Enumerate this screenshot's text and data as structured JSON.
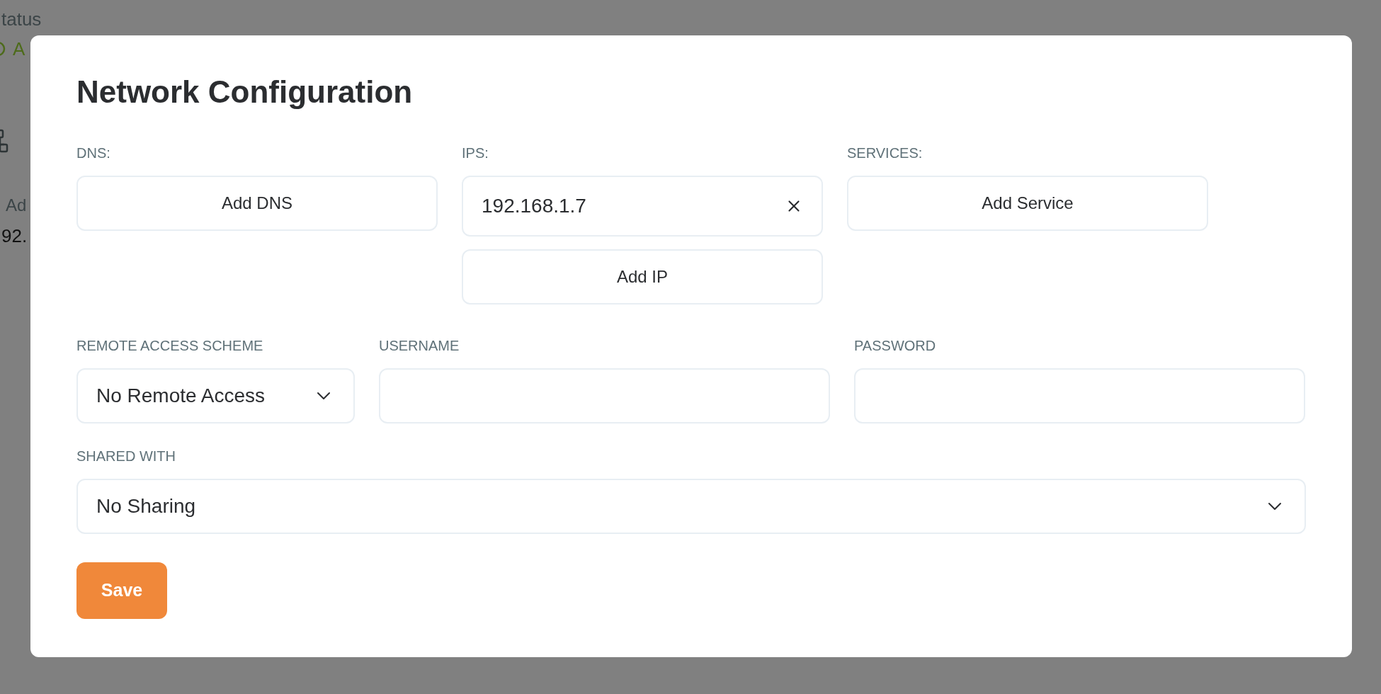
{
  "background": {
    "status_label": "tatus",
    "status_value": "A",
    "address_label": "Ad",
    "address_value": "92."
  },
  "dialog": {
    "title": "Network Configuration",
    "dns": {
      "label": "DNS:",
      "add_button": "Add DNS"
    },
    "ips": {
      "label": "IPS:",
      "entries": [
        {
          "value": "192.168.1.7"
        }
      ],
      "add_button": "Add IP"
    },
    "services": {
      "label": "SERVICES:",
      "add_button": "Add Service"
    },
    "remote_access": {
      "label": "REMOTE ACCESS SCHEME",
      "value": "No Remote Access"
    },
    "username": {
      "label": "USERNAME"
    },
    "password": {
      "label": "PASSWORD"
    },
    "shared_with": {
      "label": "SHARED WITH",
      "value": "No Sharing"
    },
    "save_button": "Save"
  }
}
